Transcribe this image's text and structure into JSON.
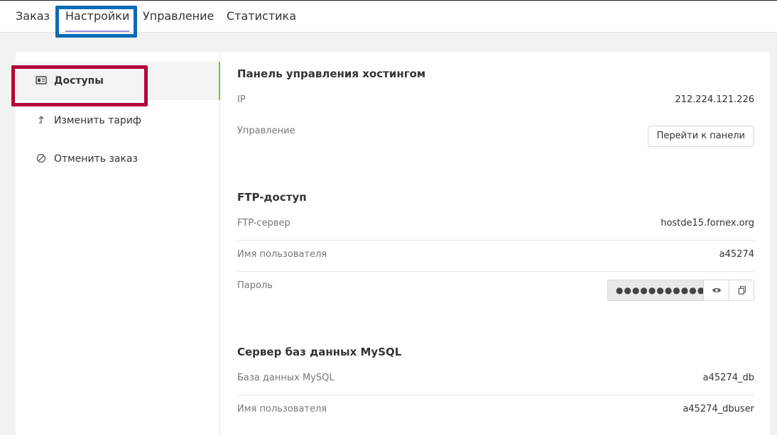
{
  "tabs": [
    {
      "label": "Заказ"
    },
    {
      "label": "Настройки"
    },
    {
      "label": "Управление"
    },
    {
      "label": "Статистика"
    }
  ],
  "sidebar": {
    "items": [
      {
        "label": "Доступы",
        "icon": "id-card-icon"
      },
      {
        "label": "Изменить тариф",
        "icon": "arrow-up-icon"
      },
      {
        "label": "Отменить заказ",
        "icon": "cancel-icon"
      }
    ]
  },
  "panel": {
    "title": "Панель управления хостингом",
    "ip_label": "IP",
    "ip_value": "212.224.121.226",
    "manage_label": "Управление",
    "manage_button": "Перейти к панели"
  },
  "ftp": {
    "title": "FTP-доступ",
    "server_label": "FTP-сервер",
    "server_value": "hostde15.fornex.org",
    "user_label": "Имя пользователя",
    "user_value": "a45274",
    "password_label": "Пароль",
    "password_value": "●●●●●●●●●●●●●●●●"
  },
  "mysql": {
    "title": "Сервер баз данных MySQL",
    "db_label": "База данных MySQL",
    "db_value": "a45274_db",
    "user_label": "Имя пользователя",
    "user_value": "a45274_dbuser"
  },
  "colors": {
    "accent_green": "#7dc142",
    "highlight_blue": "#0a6bb6",
    "highlight_red": "#b3063a",
    "tab_underline": "#9b8cd8"
  }
}
